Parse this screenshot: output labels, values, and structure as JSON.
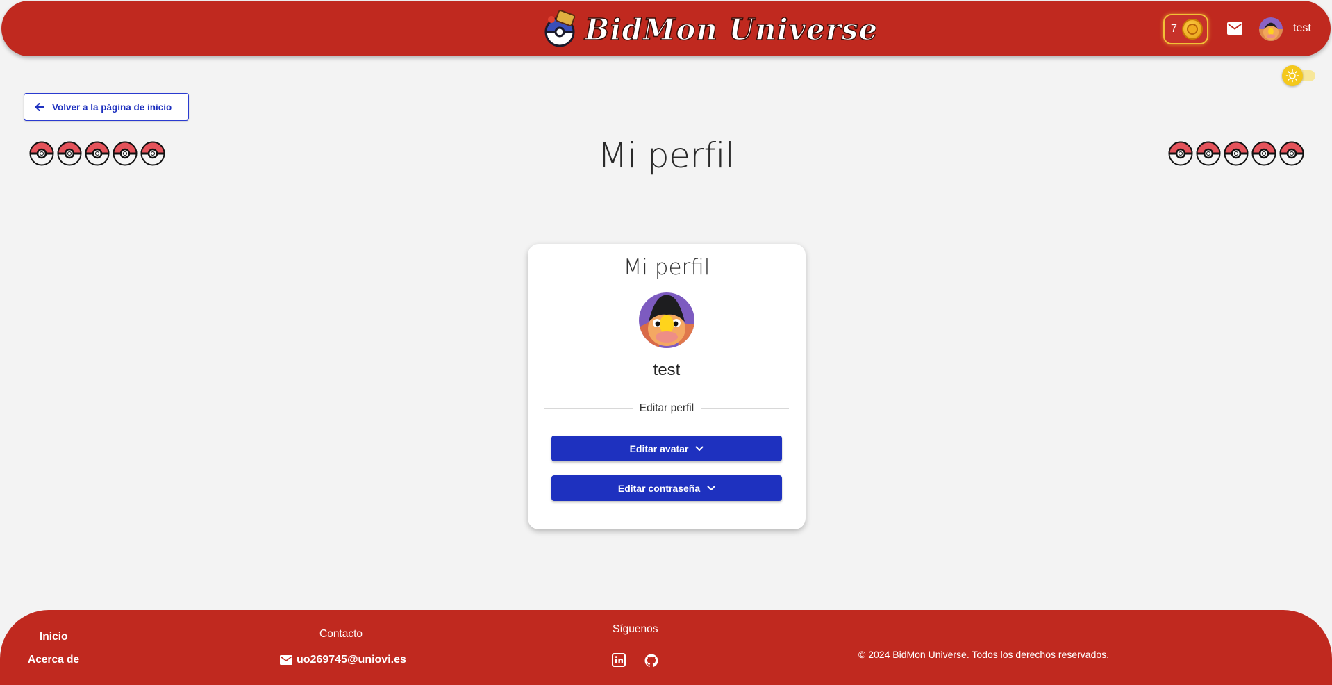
{
  "header": {
    "logo_text": "BidMon Universe",
    "coins": "7",
    "username": "test"
  },
  "back_button": {
    "label": "Volver a la página de inicio"
  },
  "page": {
    "title": "Mi perfil"
  },
  "card": {
    "title": "Mi perfil",
    "username": "test",
    "divider_label": "Editar perfil",
    "edit_avatar_label": "Editar avatar",
    "edit_password_label": "Editar contraseña"
  },
  "footer": {
    "links": {
      "home": "Inicio",
      "about": "Acerca de"
    },
    "contact_heading": "Contacto",
    "email": "uo269745@uniovi.es",
    "follow_heading": "Síguenos",
    "copyright": "© 2024 BidMon Universe. Todos los derechos reservados."
  },
  "colors": {
    "brand_red": "#c0291f",
    "primary_blue": "#1e31bf",
    "background": "#f3f3f3",
    "coin_gold": "#f2c037"
  },
  "icons": [
    "pokeball-logo-icon",
    "coin-icon",
    "mail-icon",
    "sun-icon",
    "arrow-left-icon",
    "chevron-down-icon",
    "linkedin-icon",
    "github-icon"
  ]
}
